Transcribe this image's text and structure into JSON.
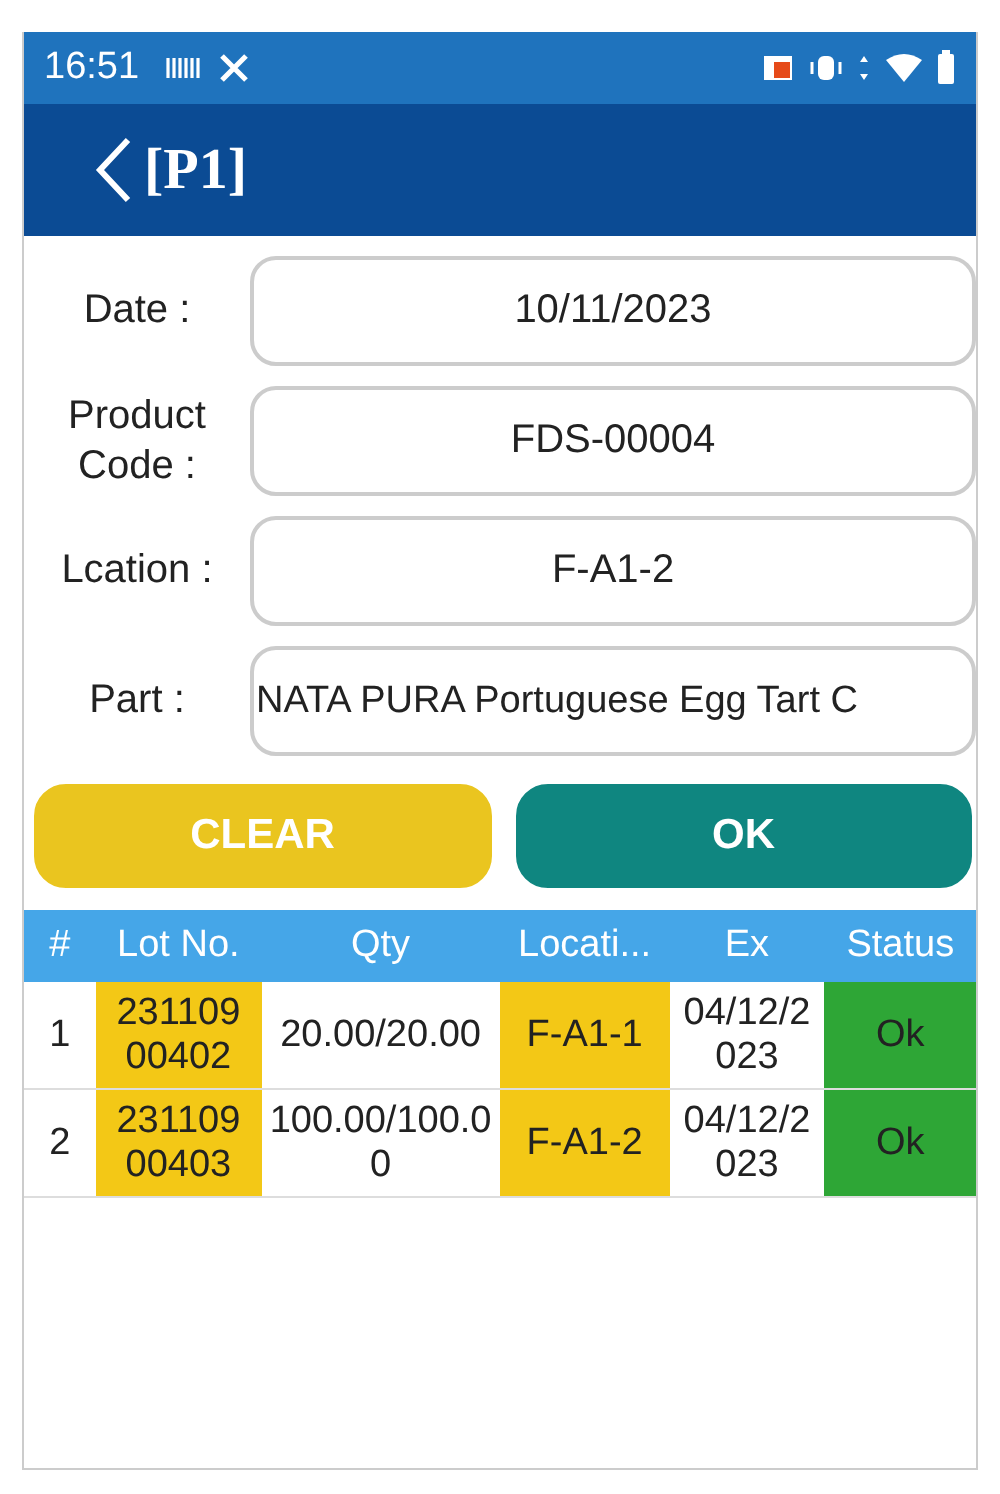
{
  "status_bar": {
    "time": "16:51"
  },
  "header": {
    "title": "[P1]"
  },
  "form": [
    {
      "label": "Date :",
      "value": "10/11/2023"
    },
    {
      "label": "Product Code :",
      "value": "FDS-00004"
    },
    {
      "label": "Lcation :",
      "value": "F-A1-2"
    },
    {
      "label": "Part :",
      "value": "NATA PURA Portuguese Egg Tart C",
      "kind": "left"
    }
  ],
  "buttons": [
    {
      "label": "CLEAR",
      "kind": "clear"
    },
    {
      "label": "OK",
      "kind": "ok"
    }
  ],
  "table": {
    "columns": [
      "#",
      "Lot No.",
      "Qty",
      "Locati...",
      "Ex",
      "Status"
    ],
    "rows": [
      [
        "1",
        "23110900402",
        "20.00/20.00",
        "F-A1-1",
        "04/12/2023",
        "Ok"
      ],
      [
        "2",
        "23110900403",
        "100.00/100.00",
        "F-A1-2",
        "04/12/2023",
        "Ok"
      ]
    ]
  }
}
